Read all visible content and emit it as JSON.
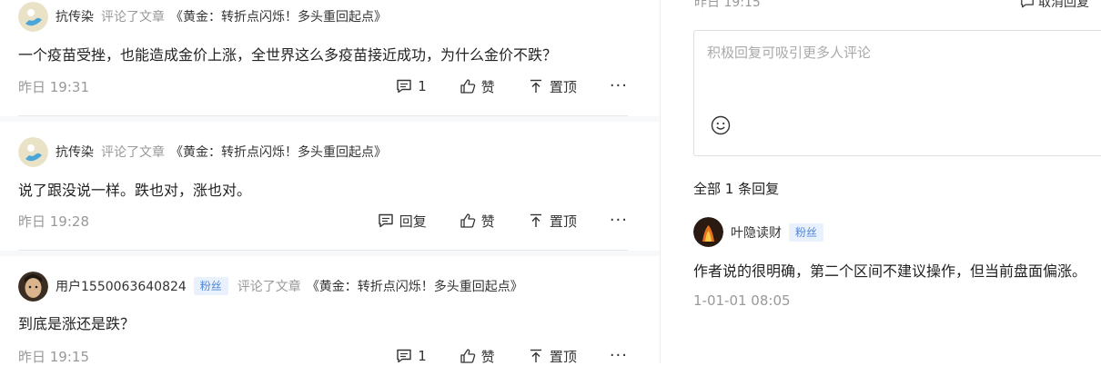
{
  "comments": [
    {
      "user": "抗传染",
      "action": "评论了文章",
      "article": "《黄金：转折点闪烁！多头重回起点》",
      "text": "一个疫苗受挫，也能造成金价上涨，全世界这么多疫苗接近成功，为什么金价不跌？",
      "time": "昨日 19:31",
      "reply_count": "1",
      "like_label": "赞",
      "pin_label": "置顶",
      "more": "···"
    },
    {
      "user": "抗传染",
      "action": "评论了文章",
      "article": "《黄金：转折点闪烁！多头重回起点》",
      "text": "说了跟没说一样。跌也对，涨也对。",
      "time": "昨日 19:28",
      "reply_label": "回复",
      "like_label": "赞",
      "pin_label": "置顶",
      "more": "···"
    },
    {
      "user": "用户1550063640824",
      "badge": "粉丝",
      "action": "评论了文章",
      "article": "《黄金：转折点闪烁！多头重回起点》",
      "text": "到底是涨还是跌？",
      "time": "昨日 19:15",
      "reply_count": "1",
      "like_label": "赞",
      "pin_label": "置顶",
      "more": "···"
    }
  ],
  "panel": {
    "top_time": "昨日 19:15",
    "cancel_label": "取消回复",
    "placeholder": "积极回复可吸引更多人评论",
    "count_label": "全部 1 条回复",
    "reply": {
      "user": "叶隐读财",
      "badge": "粉丝",
      "text": "作者说的很明确，第二个区间不建议操作，但当前盘面偏涨。",
      "time": "1-01-01 08:05"
    }
  },
  "icons": {
    "comment": "comment-icon",
    "like": "thumbs-up-icon",
    "pin": "pin-top-icon",
    "emoji": "smiley-icon"
  },
  "colors": {
    "badge_bg": "#e9f1fd",
    "badge_text": "#4e86d9",
    "muted": "#999999",
    "left_bg": "#f7f8fa"
  }
}
